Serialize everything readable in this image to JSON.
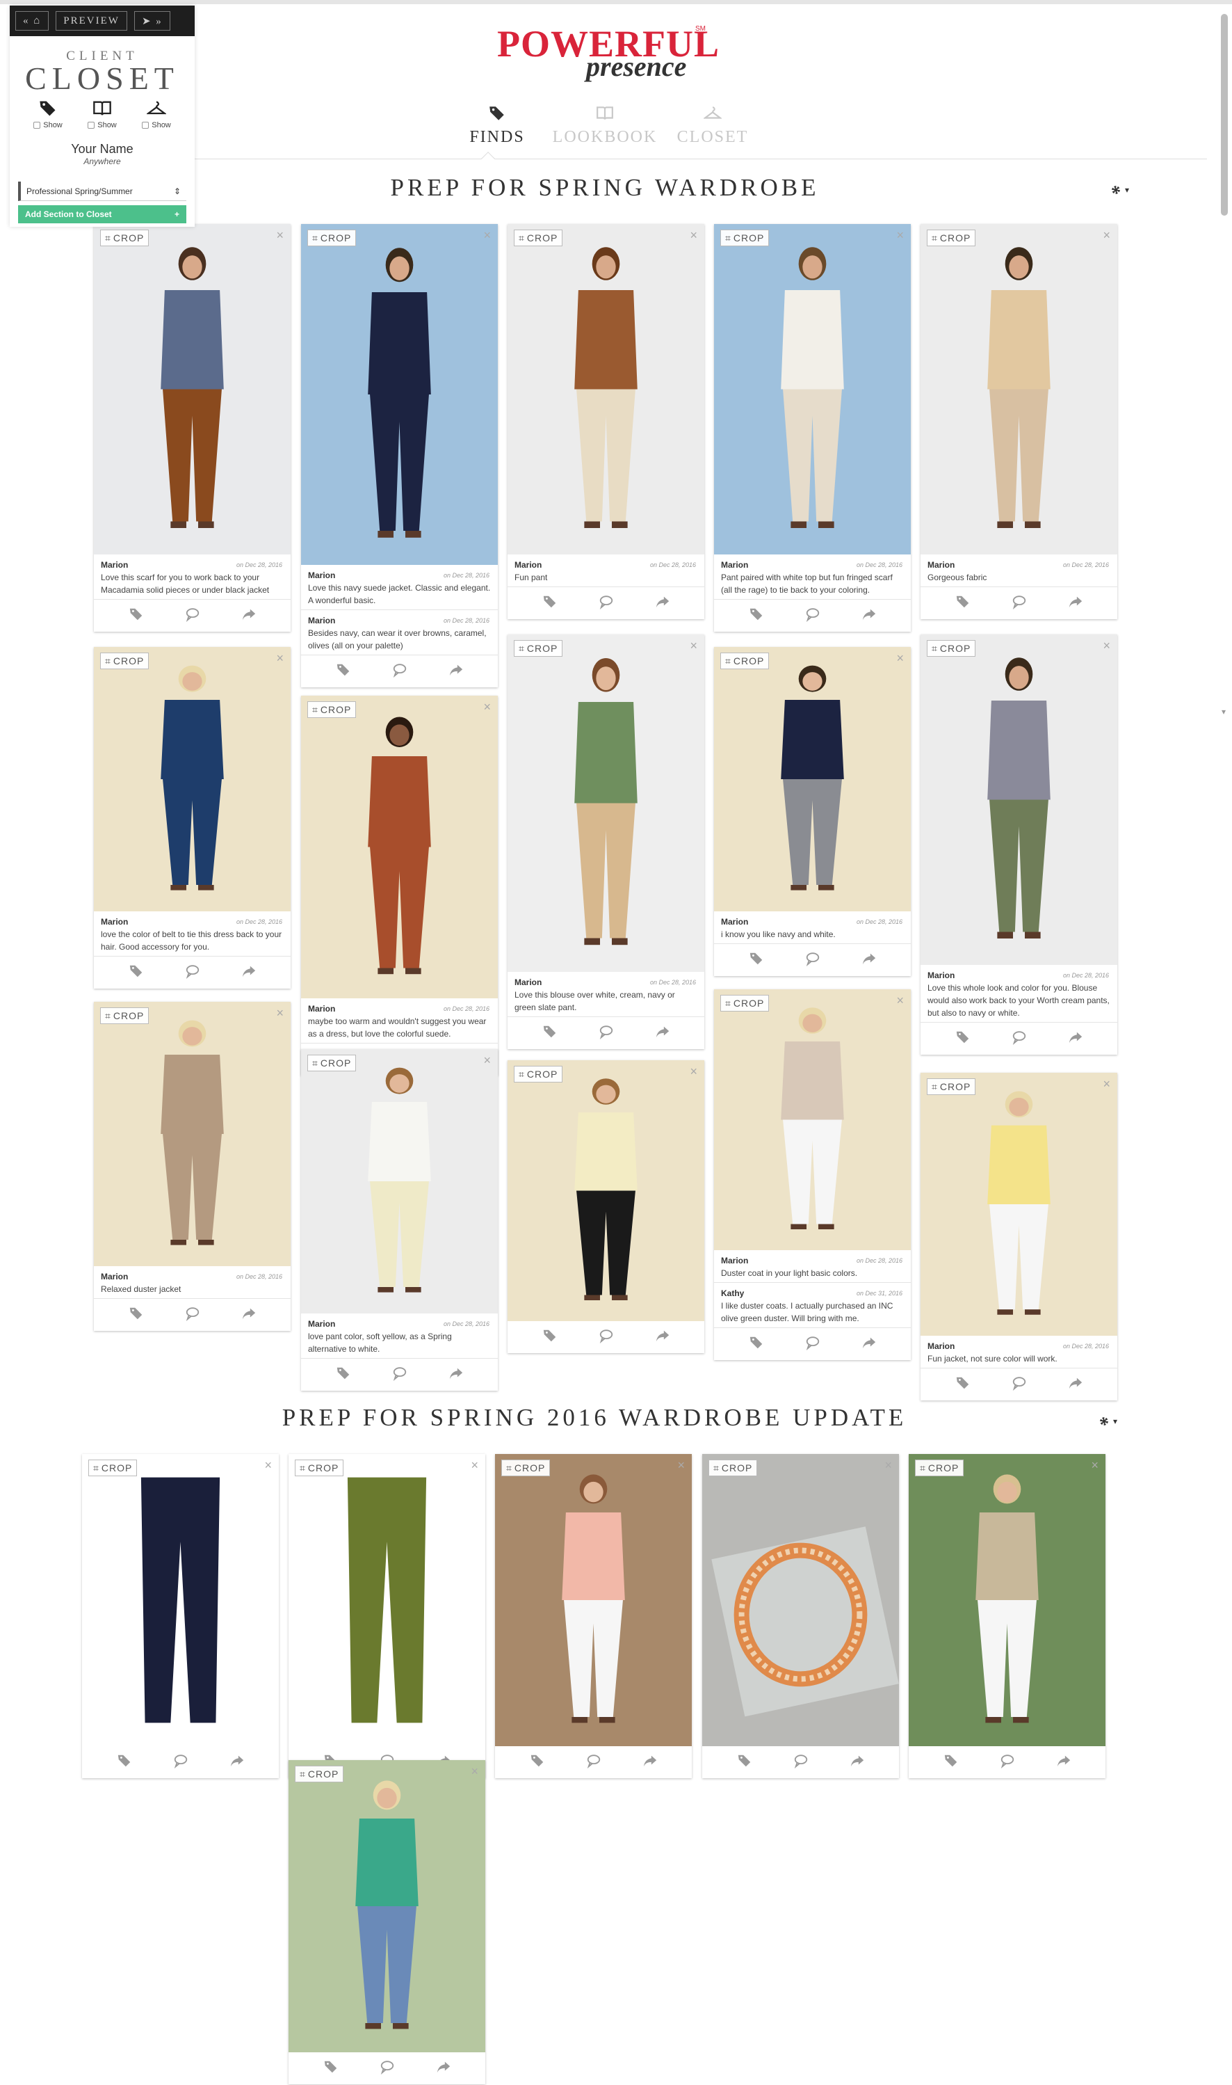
{
  "panel": {
    "preview_label": "PREVIEW",
    "title_small": "CLIENT",
    "title_big": "CLOSET",
    "show_labels": [
      "Show",
      "Show",
      "Show"
    ],
    "user_name": "Your Name",
    "user_location": "Anywhere",
    "select_value": "Professional Spring/Summer",
    "add_section_label": "Add Section to Closet",
    "add_icon": "+"
  },
  "brand": {
    "main": "POWERFUL",
    "sm": "SM",
    "sub": "presence",
    "color": "#d9243a"
  },
  "nav": {
    "tabs": [
      "FINDS",
      "LOOKBOOK",
      "CLOSET"
    ],
    "active": "FINDS"
  },
  "sections": [
    {
      "title": "PREP FOR SPRING WARDROBE",
      "cards": [
        {
          "crop": "CROP",
          "bg": "#e9eaec",
          "comments": [
            {
              "author": "Marion",
              "date": "on Dec 28, 2016",
              "text": "Love this scarf for you to work back to your Macadamia solid pieces or under black jacket"
            }
          ]
        },
        {
          "crop": "CROP",
          "bg": "#9fc1dd",
          "comments": [
            {
              "author": "Marion",
              "date": "on Dec 28, 2016",
              "text": "Love this navy suede jacket. Classic and elegant. A wonderful basic."
            },
            {
              "author": "Marion",
              "date": "on Dec 28, 2016",
              "text": "Besides navy, can wear it over browns, caramel, olives (all on your palette)"
            }
          ]
        },
        {
          "crop": "CROP",
          "bg": "#ececec",
          "comments": [
            {
              "author": "Marion",
              "date": "on Dec 28, 2016",
              "text": "Fun pant"
            }
          ]
        },
        {
          "crop": "CROP",
          "bg": "#9fc1dd",
          "comments": [
            {
              "author": "Marion",
              "date": "on Dec 28, 2016",
              "text": "Pant paired with white top but fun fringed scarf (all the rage) to tie back to your coloring."
            }
          ]
        },
        {
          "crop": "CROP",
          "bg": "#ececec",
          "comments": [
            {
              "author": "Marion",
              "date": "on Dec 28, 2016",
              "text": "Gorgeous fabric"
            }
          ]
        },
        {
          "crop": "CROP",
          "bg": "#ede3c8",
          "comments": [
            {
              "author": "Marion",
              "date": "on Dec 28, 2016",
              "text": "love the color of belt to tie this dress back to your hair. Good accessory for you."
            }
          ]
        },
        {
          "crop": "CROP",
          "bg": "#ede3c8",
          "comments": [
            {
              "author": "Marion",
              "date": "on Dec 28, 2016",
              "text": "maybe too warm and wouldn't suggest you wear as a dress, but love the colorful suede."
            }
          ]
        },
        {
          "crop": "CROP",
          "bg": "#eeeeee",
          "comments": [
            {
              "author": "Marion",
              "date": "on Dec 28, 2016",
              "text": "Love this blouse over white, cream, navy or green slate pant."
            }
          ]
        },
        {
          "crop": "CROP",
          "bg": "#ede3c8",
          "comments": [
            {
              "author": "Marion",
              "date": "on Dec 28, 2016",
              "text": "i know you like navy and white."
            }
          ]
        },
        {
          "crop": "CROP",
          "bg": "#ececec",
          "comments": [
            {
              "author": "Marion",
              "date": "on Dec 28, 2016",
              "text": "Love this whole look and color for you. Blouse would also work back to your Worth cream pants, but also to navy or white."
            }
          ]
        },
        {
          "crop": "CROP",
          "bg": "#ede3c8",
          "comments": [
            {
              "author": "Marion",
              "date": "on Dec 28, 2016",
              "text": "Relaxed duster jacket"
            }
          ]
        },
        {
          "crop": "CROP",
          "bg": "#ececec",
          "comments": [
            {
              "author": "Marion",
              "date": "on Dec 28, 2016",
              "text": "love pant color, soft yellow, as a Spring alternative to white."
            }
          ]
        },
        {
          "crop": "CROP",
          "bg": "#ede3c8",
          "comments": []
        },
        {
          "crop": "CROP",
          "bg": "#ede3c8",
          "comments": [
            {
              "author": "Marion",
              "date": "on Dec 28, 2016",
              "text": "Duster coat in your light basic colors."
            },
            {
              "author": "Kathy",
              "date": "on Dec 31, 2016",
              "text": "I like duster coats. I actually purchased an INC olive green duster. Will bring with me."
            }
          ]
        },
        {
          "crop": "CROP",
          "bg": "#ede3c8",
          "comments": [
            {
              "author": "Marion",
              "date": "on Dec 28, 2016",
              "text": "Fun jacket, not sure color will work."
            }
          ]
        }
      ]
    },
    {
      "title": "PREP FOR SPRING 2016 WARDROBE UPDATE",
      "cards": [
        {
          "crop": "CROP",
          "bg": "#ffffff",
          "comments": []
        },
        {
          "crop": "CROP",
          "bg": "#ffffff",
          "comments": []
        },
        {
          "crop": "CROP",
          "bg": "#a8896a",
          "comments": []
        },
        {
          "crop": "CROP",
          "bg": "#b9b9b6",
          "comments": []
        },
        {
          "crop": "CROP",
          "bg": "#6f8e5a",
          "comments": []
        },
        {
          "crop": "CROP",
          "bg": "#b6c7a0",
          "comments": []
        }
      ]
    }
  ]
}
